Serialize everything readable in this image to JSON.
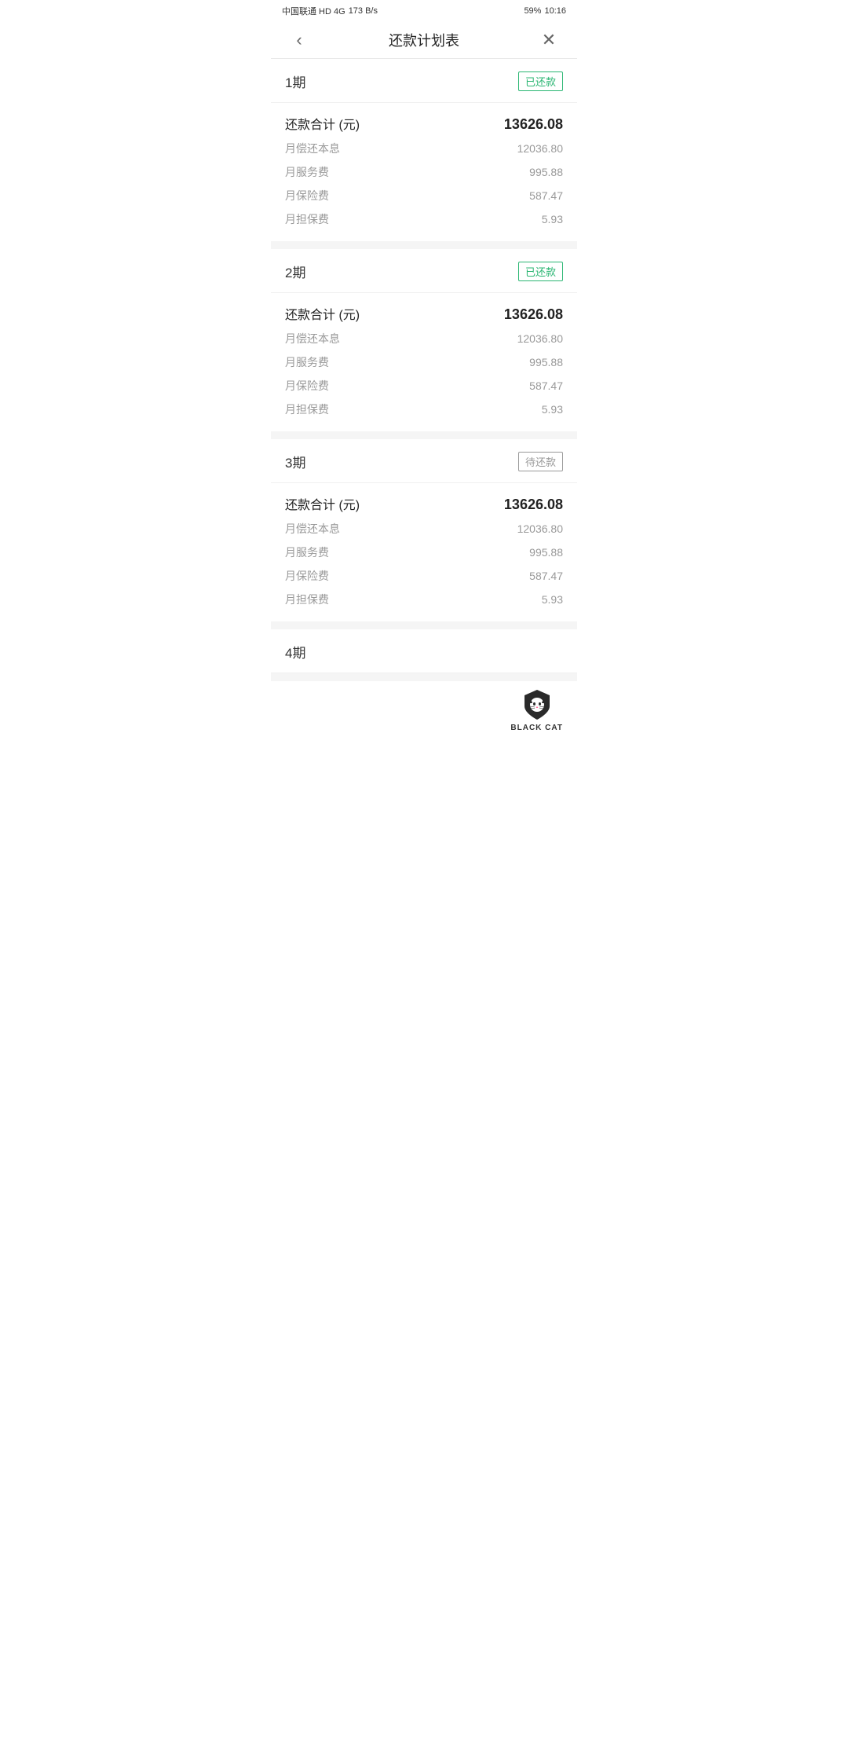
{
  "statusBar": {
    "carrier": "中国联通 HD 4G",
    "speed": "173 B/s",
    "time": "10:16",
    "battery": "59%"
  },
  "nav": {
    "title": "还款计划表",
    "backLabel": "‹",
    "closeLabel": "✕"
  },
  "periods": [
    {
      "id": "period-1",
      "label": "1期",
      "statusLabel": "已还款",
      "statusType": "paid",
      "total": {
        "label": "还款合计 (元)",
        "value": "13626.08"
      },
      "items": [
        {
          "label": "月偿还本息",
          "value": "12036.80"
        },
        {
          "label": "月服务费",
          "value": "995.88"
        },
        {
          "label": "月保险费",
          "value": "587.47"
        },
        {
          "label": "月担保费",
          "value": "5.93"
        }
      ]
    },
    {
      "id": "period-2",
      "label": "2期",
      "statusLabel": "已还款",
      "statusType": "paid",
      "total": {
        "label": "还款合计 (元)",
        "value": "13626.08"
      },
      "items": [
        {
          "label": "月偿还本息",
          "value": "12036.80"
        },
        {
          "label": "月服务费",
          "value": "995.88"
        },
        {
          "label": "月保险费",
          "value": "587.47"
        },
        {
          "label": "月担保费",
          "value": "5.93"
        }
      ]
    },
    {
      "id": "period-3",
      "label": "3期",
      "statusLabel": "待还款",
      "statusType": "pending",
      "total": {
        "label": "还款合计 (元)",
        "value": "13626.08"
      },
      "items": [
        {
          "label": "月偿还本息",
          "value": "12036.80"
        },
        {
          "label": "月服务费",
          "value": "995.88"
        },
        {
          "label": "月保险费",
          "value": "587.47"
        },
        {
          "label": "月担保费",
          "value": "5.93"
        }
      ]
    },
    {
      "id": "period-4",
      "label": "4期",
      "statusLabel": "",
      "statusType": "pending",
      "total": null,
      "items": []
    }
  ],
  "watermark": {
    "text": "BLACK CAT"
  }
}
